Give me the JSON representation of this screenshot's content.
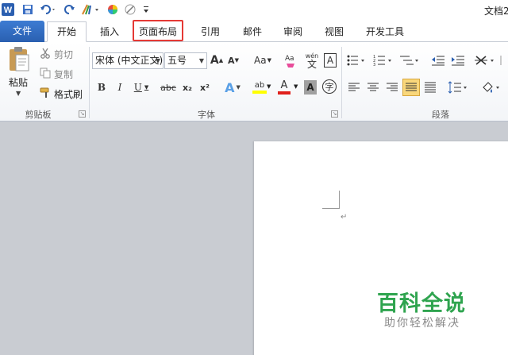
{
  "window": {
    "title": "文档2"
  },
  "tabs": [
    {
      "label": "文件"
    },
    {
      "label": "开始"
    },
    {
      "label": "插入"
    },
    {
      "label": "页面布局"
    },
    {
      "label": "引用"
    },
    {
      "label": "邮件"
    },
    {
      "label": "审阅"
    },
    {
      "label": "视图"
    },
    {
      "label": "开发工具"
    }
  ],
  "clipboard": {
    "paste": "粘贴",
    "cut": "剪切",
    "copy": "复制",
    "format_painter": "格式刷",
    "group_label": "剪贴板"
  },
  "font": {
    "font_name": "宋体 (中文正文)",
    "font_size": "五号",
    "group_label": "字体",
    "bold": "B",
    "italic": "I",
    "underline": "U",
    "strike": "abc",
    "subscript": "x₂",
    "superscript": "x²",
    "grow": "A",
    "shrink": "A",
    "change_case": "Aa",
    "wen": "wén",
    "wen_char": "文",
    "border_char": "A",
    "text_effect": "A",
    "highlight": "ab",
    "font_color": "A",
    "shading_char": "A",
    "enclose_char": "字"
  },
  "paragraph": {
    "group_label": "段落"
  },
  "watermark": {
    "title": "百科全说",
    "subtitle": "助你轻松解决"
  },
  "colors": {
    "accent": "#2b5fb0",
    "highlight_box": "#e53935",
    "watermark": "#2fa44f"
  }
}
